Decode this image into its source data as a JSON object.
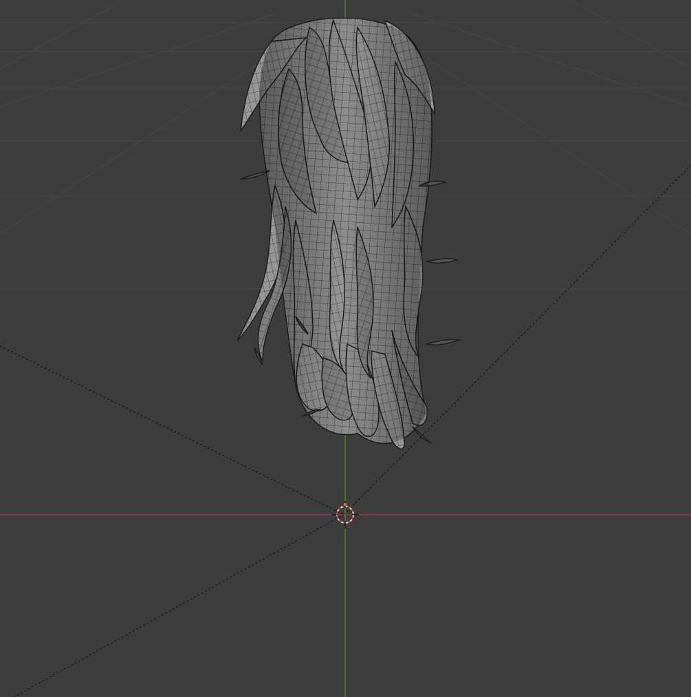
{
  "viewport": {
    "background_color": "#3d3d3d",
    "grid_color": "#4a4a4a",
    "x_axis_color": "#b33a45",
    "y_axis_color": "#5c8f2c",
    "camera_frustum_color": "#1a1a1a",
    "mesh_fill_color": "#8a8a8a",
    "mesh_wire_color": "#2a2a2a",
    "selected_object": "hair-mesh",
    "show_grid": true,
    "show_wireframe_overlay": true
  },
  "scene_objects": [
    {
      "name": "hair-mesh",
      "type": "mesh"
    },
    {
      "name": "3d-cursor",
      "type": "cursor"
    }
  ]
}
